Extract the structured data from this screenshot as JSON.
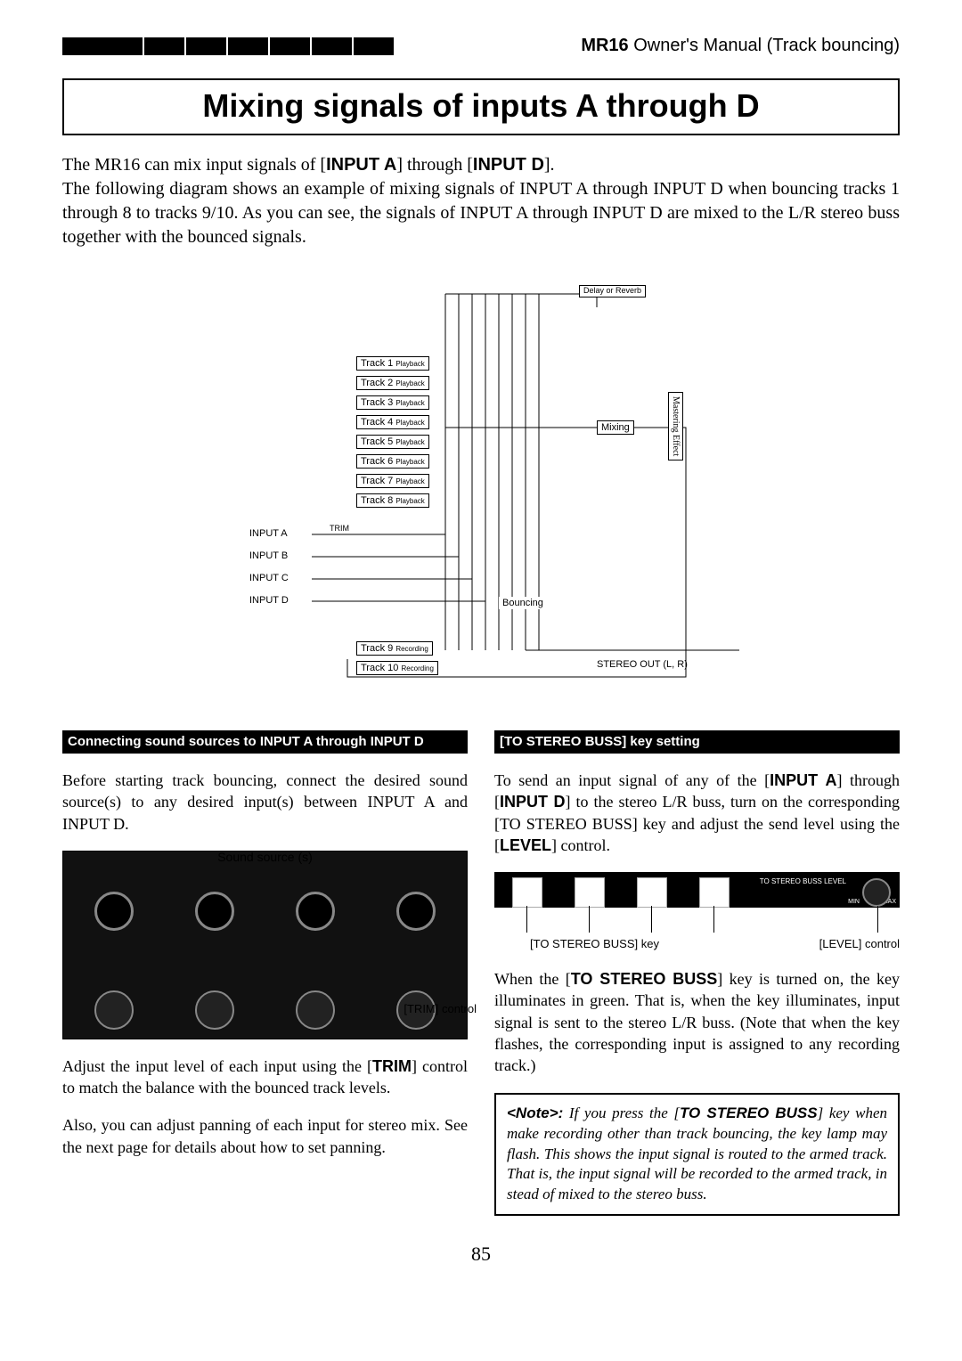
{
  "header": {
    "product": "MR16",
    "manual_section": "Owner's Manual (Track bouncing)"
  },
  "title": "Mixing signals of inputs A through D",
  "intro": {
    "line1_a": "The MR16 can mix input signals of [",
    "input_a": "INPUT A",
    "line1_b": "] through [",
    "input_d": "INPUT D",
    "line1_c": "].",
    "line2": "The following diagram shows an example of mixing signals of INPUT A through INPUT D when bouncing tracks 1 through 8 to tracks 9/10. As you can see, the signals of INPUT A through INPUT D are mixed to the L/R stereo buss together with the bounced signals."
  },
  "diagram": {
    "delay_label": "Delay or Reverb",
    "tracks": [
      "Track 1",
      "Track 2",
      "Track 3",
      "Track 4",
      "Track 5",
      "Track 6",
      "Track 7",
      "Track 8"
    ],
    "playback": "Playback",
    "inputs": [
      "INPUT A",
      "INPUT B",
      "INPUT C",
      "INPUT D"
    ],
    "trim": "TRIM",
    "mixing": "Mixing",
    "bouncing": "Bouncing",
    "mastering_effect": "Mastering Effect",
    "track9": "Track 9",
    "track10": "Track 10",
    "recording": "Recording",
    "stereo_out": "STEREO OUT (L, R)"
  },
  "left": {
    "subhead": "Connecting sound sources to INPUT A through INPUT D",
    "p1": "Before starting track bouncing, connect the desired sound source(s) to any desired input(s) between INPUT A and INPUT D.",
    "sound_source_label": "Sound source (s)",
    "trim_control_label": "[TRIM] control",
    "p2_a": "Adjust the input level of each input using the [",
    "p2_trim": "TRIM",
    "p2_b": "] control to match the balance with the bounced track levels.",
    "p3": "Also, you can adjust panning of each input for stereo mix. See the next page for details about how to set panning."
  },
  "right": {
    "subhead": "[TO STEREO BUSS] key setting",
    "p1_a": "To send an input signal of any of the [",
    "p1_input_a": "INPUT A",
    "p1_b": "] through [",
    "p1_input_d": "INPUT D",
    "p1_c": "] to the stereo L/R buss, turn on the corresponding [TO STEREO BUSS] key and adjust the send level using the [",
    "p1_level": "LEVEL",
    "p1_d": "] control.",
    "key_label": "[TO STEREO BUSS] key",
    "level_label": "[LEVEL] control",
    "strip_label": "TO STEREO BUSS LEVEL",
    "min": "MIN",
    "max": "MAX",
    "p2_a": "When the [",
    "p2_buss": "TO STEREO BUSS",
    "p2_b": "] key is turned on, the key illuminates in green. That is, when the key illuminates, input signal is sent to the stereo L/R buss. (Note that when the key flashes, the corresponding input is assigned to any recording track.)",
    "note_a": "<Note>:",
    "note_b": " If you press the [",
    "note_buss": "TO STEREO BUSS",
    "note_c": "] key when make recording other than track bouncing, the key lamp may flash. This shows the input signal is routed to the armed track. That is, the input signal will be recorded to the armed track, in stead of mixed to the stereo buss."
  },
  "page_number": "85"
}
